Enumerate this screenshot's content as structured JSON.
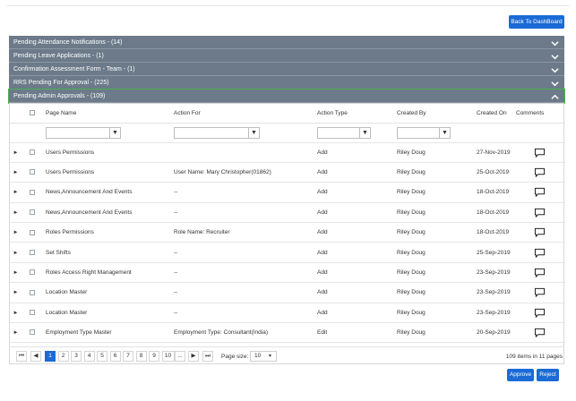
{
  "header": {
    "back_label": "Back To DashBoard"
  },
  "accordion": [
    {
      "label": "Pending Attendance Notifications - (14)",
      "icon": "chevron-down-icon"
    },
    {
      "label": "Pending Leave Applications - (1)",
      "icon": "chevron-down-icon"
    },
    {
      "label": "Confirmation Assessment Form - Team - (1)",
      "icon": "chevron-down-icon"
    },
    {
      "label": "RRS Pending For Approval - (225)",
      "icon": "chevron-down-icon"
    },
    {
      "label": "Pending Admin Approvals - (109)",
      "icon": "chevron-up-icon"
    }
  ],
  "grid": {
    "columns": [
      "Page Name",
      "Action For",
      "Action Type",
      "Created By",
      "Created On",
      "Comments"
    ],
    "rows": [
      {
        "page": "Users Permissions",
        "action_for": "",
        "type": "Add",
        "by": "Riley Doug",
        "on": "27-Nov-2019"
      },
      {
        "page": "Users Permissions",
        "action_for": "User Name: Mary Christopher(01862)",
        "type": "Add",
        "by": "Riley Doug",
        "on": "25-Oct-2019"
      },
      {
        "page": "News,Announcement And Events",
        "action_for": "--",
        "type": "Add",
        "by": "Riley Doug",
        "on": "18-Oct-2019"
      },
      {
        "page": "News,Announcement And Events",
        "action_for": "--",
        "type": "Add",
        "by": "Riley Doug",
        "on": "18-Oct-2019"
      },
      {
        "page": "Roles Permissions",
        "action_for": "Role Name: Recruiter",
        "type": "Add",
        "by": "Riley Doug",
        "on": "18-Oct-2019"
      },
      {
        "page": "Set Shifts",
        "action_for": "--",
        "type": "Add",
        "by": "Riley Doug",
        "on": "25-Sep-2019"
      },
      {
        "page": "Roles Access Right Management",
        "action_for": "--",
        "type": "Add",
        "by": "Riley Doug",
        "on": "23-Sep-2019"
      },
      {
        "page": "Location Master",
        "action_for": "--",
        "type": "Add",
        "by": "Riley Doug",
        "on": "23-Sep-2019"
      },
      {
        "page": "Location Master",
        "action_for": "--",
        "type": "Add",
        "by": "Riley Doug",
        "on": "23-Sep-2019"
      },
      {
        "page": "Employment Type Master",
        "action_for": "Employment Type: Consultant(India)",
        "type": "Edit",
        "by": "Riley Doug",
        "on": "20-Sep-2019"
      }
    ]
  },
  "pager": {
    "first": "⏮",
    "prev": "◀",
    "pages": [
      "1",
      "2",
      "3",
      "4",
      "5",
      "6",
      "7",
      "8",
      "9",
      "10",
      "..."
    ],
    "next": "▶",
    "last": "⏭",
    "page_size_label": "Page size:",
    "page_size": "10",
    "items_info": "109 items in 11 pages"
  },
  "actions": {
    "approve": "Approve",
    "reject": "Reject"
  },
  "colors": {
    "accent": "#1a6bd6",
    "accordion_bg": "#6c7a89",
    "active_outline": "#4caf50"
  }
}
